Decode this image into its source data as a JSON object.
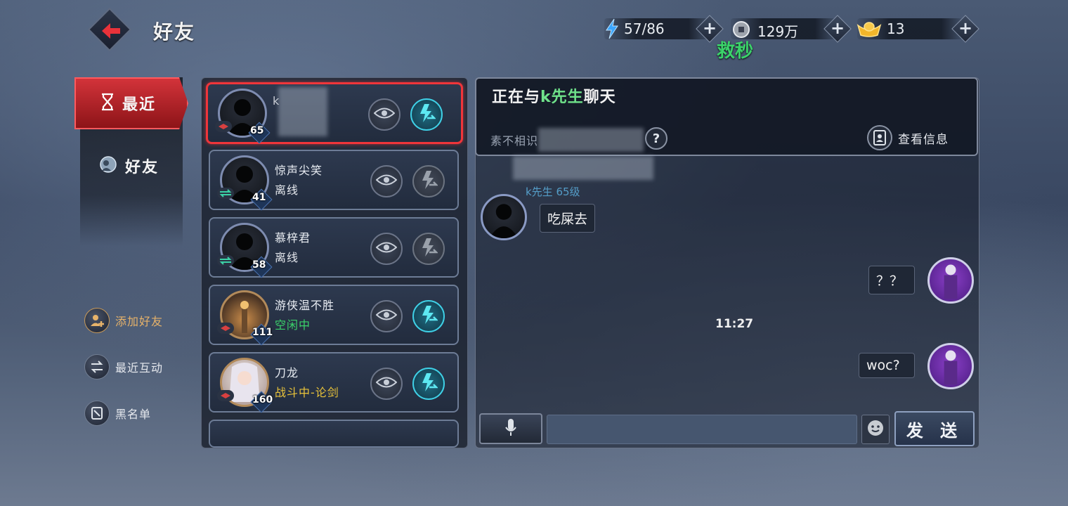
{
  "header": {
    "title": "好友",
    "resources": [
      {
        "icon": "stamina-icon",
        "value": "57/86",
        "color": "#3aa6ff"
      },
      {
        "icon": "coin-icon",
        "value": "129万",
        "color": "#c8ccd2"
      },
      {
        "icon": "gold-ingot-icon",
        "value": "13",
        "color": "#f2b62a"
      }
    ],
    "overlay_text": "救秒"
  },
  "nav": {
    "tabs": [
      {
        "label": "最近",
        "icon": "hourglass-icon",
        "active": true
      },
      {
        "label": "好友",
        "icon": "friends-icon",
        "active": false
      }
    ],
    "actions": [
      {
        "label": "添加好友",
        "icon": "add-friend-icon"
      },
      {
        "label": "最近互动",
        "icon": "interaction-icon"
      },
      {
        "label": "黑名单",
        "icon": "blacklist-icon"
      }
    ]
  },
  "friends": [
    {
      "name": "k",
      "status": "",
      "status_color": "#3bd26a",
      "level": "65",
      "selected": true,
      "action_enabled": true
    },
    {
      "name": "惊声尖笑",
      "status": "离线",
      "status_color": "#e6e9ee",
      "level": "41",
      "selected": false,
      "action_enabled": false
    },
    {
      "name": "慕梓君",
      "status": "离线",
      "status_color": "#e6e9ee",
      "level": "58",
      "selected": false,
      "action_enabled": false
    },
    {
      "name": "游侠温不胜",
      "status": "空闲中",
      "status_color": "#3bd26a",
      "level": "111",
      "selected": false,
      "action_enabled": true
    },
    {
      "name": "刀龙",
      "status": "战斗中-论剑",
      "status_color": "#e8c23a",
      "level": "160",
      "selected": false,
      "action_enabled": true
    }
  ],
  "chat": {
    "title_prefix": "正在与",
    "partner": "k先生",
    "title_suffix": "聊天",
    "relation": "素不相识",
    "view_info_label": "查看信息",
    "help_label": "?",
    "sender_tag": "k先生 65级",
    "messages": [
      {
        "from": "partner",
        "text": "吃屎去"
      },
      {
        "from": "me",
        "text": "？？"
      },
      {
        "from": "me",
        "text": "woc?"
      }
    ],
    "timestamp": "11:27",
    "input_value": "",
    "send_label": "发 送"
  }
}
